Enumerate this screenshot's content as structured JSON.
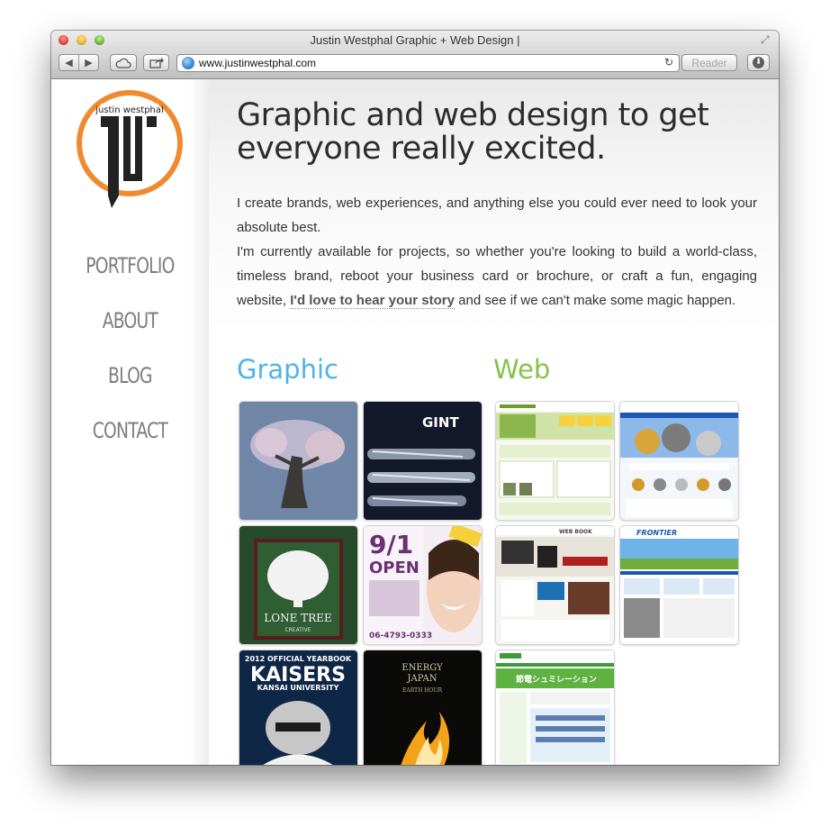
{
  "window": {
    "title": "Justin Westphal Graphic + Web Design |",
    "url": "www.justinwestphal.com",
    "reader_label": "Reader",
    "nav_back_icon": "back-arrow-icon",
    "nav_forward_icon": "forward-arrow-icon"
  },
  "logo": {
    "wordmark": "justin westphal",
    "accent_color": "#f08a30"
  },
  "sidebar": {
    "items": [
      {
        "label": "PORTFOLIO"
      },
      {
        "label": "ABOUT"
      },
      {
        "label": "BLOG"
      },
      {
        "label": "CONTACT"
      }
    ]
  },
  "main": {
    "headline": "Graphic and web design to get everyone really excited.",
    "intro_p1": "I create brands, web experiences, and anything else you could ever need to look your absolute best.",
    "intro_p2_before": "I'm currently available for projects, so whether you're looking to build a world-class, timeless brand, reboot your business card or brochure, or craft a fun, engaging website, ",
    "intro_link": "I'd love to hear your story",
    "intro_p2_after": " and see if we can't make some magic happen."
  },
  "sections": {
    "graphic": {
      "title": "Graphic",
      "color": "#4fb3e8"
    },
    "web": {
      "title": "Web",
      "color": "#86c24a"
    }
  },
  "thumbs": {
    "graphic": [
      {
        "id": "world-tree"
      },
      {
        "id": "gint",
        "text": "GINT"
      },
      {
        "id": "lone-tree",
        "text": "LONE TREE",
        "sub": "CREATIVE"
      },
      {
        "id": "open-91",
        "big": "9/1",
        "word": "OPEN",
        "phone": "06-4793-0333"
      },
      {
        "id": "kaisers",
        "top": "2012 OFFICIAL YEARBOOK",
        "big": "KAISERS",
        "sub": "KANSAI UNIVERSITY"
      },
      {
        "id": "energy-japan",
        "l1": "ENERGY",
        "l2": "JAPAN",
        "l3": "EARTH HOUR"
      }
    ],
    "web": [
      {
        "id": "web-green"
      },
      {
        "id": "web-machinery"
      },
      {
        "id": "web-book",
        "text": "WEB BOOK"
      },
      {
        "id": "web-frontier",
        "text": "FRONTIER"
      },
      {
        "id": "web-setsuden",
        "text": "節電シュミレーション"
      }
    ]
  }
}
